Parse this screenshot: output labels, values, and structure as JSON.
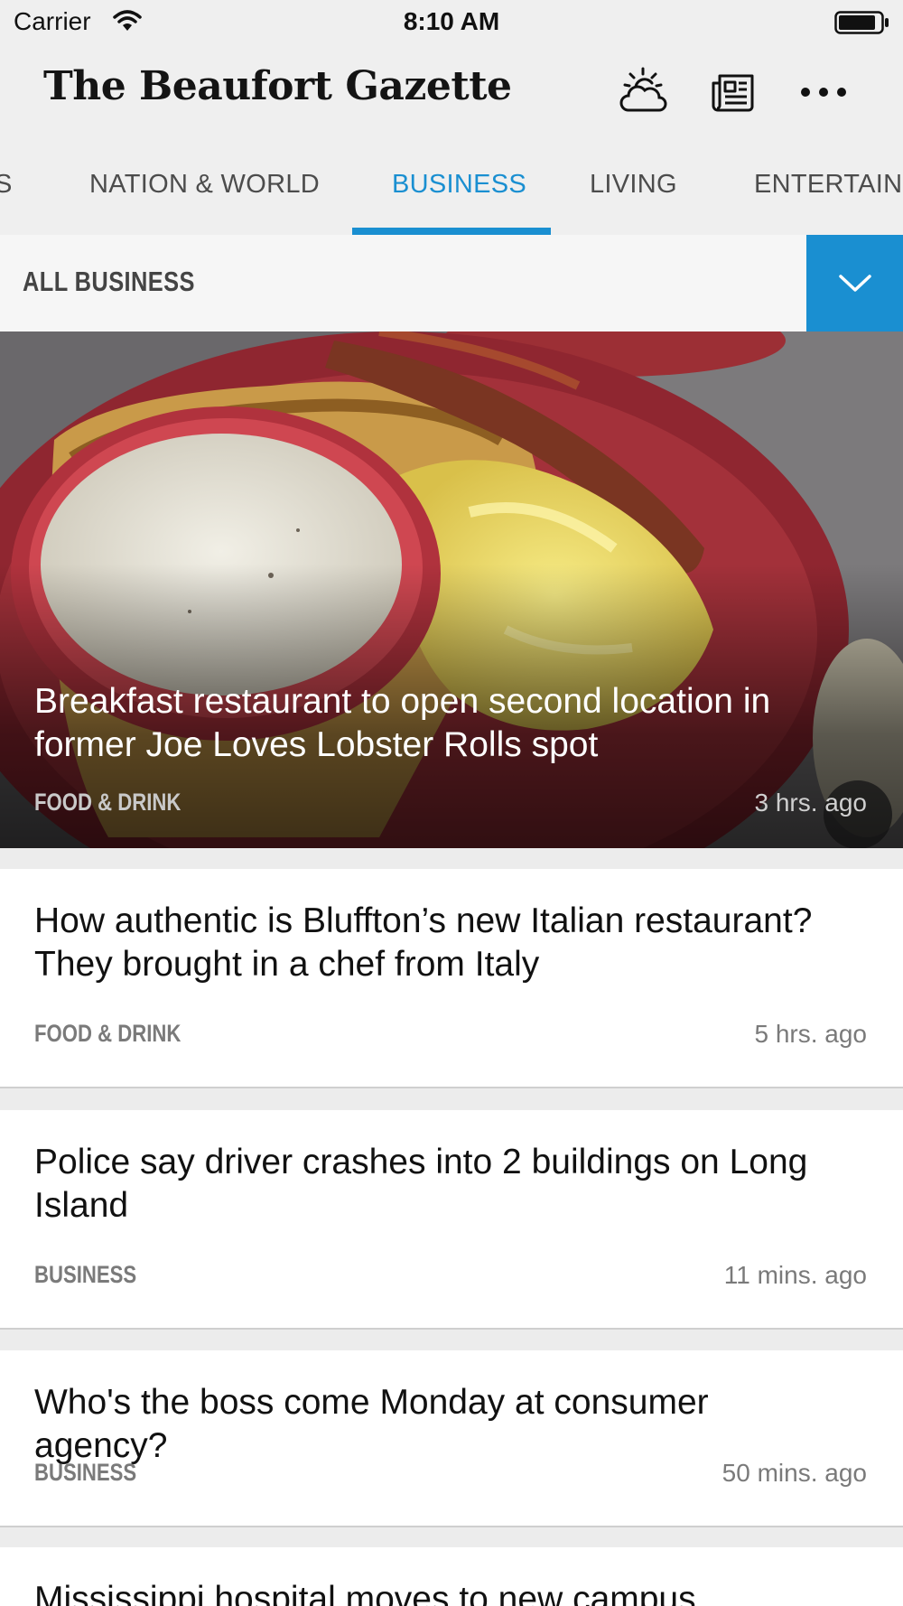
{
  "status_bar": {
    "carrier": "Carrier",
    "time": "8:10 AM",
    "icons": [
      "wifi-icon",
      "battery-icon"
    ]
  },
  "header": {
    "masthead": "The Beaufort Gazette",
    "icons": [
      "weather-icon",
      "epaper-icon",
      "more-icon"
    ]
  },
  "tabs": {
    "items": [
      {
        "label": "S"
      },
      {
        "label": "NATION & WORLD"
      },
      {
        "label": "BUSINESS",
        "active": true
      },
      {
        "label": "LIVING"
      },
      {
        "label": "ENTERTAINM"
      }
    ]
  },
  "section": {
    "title": "ALL BUSINESS",
    "toggle_icon": "chevron-down-icon"
  },
  "colors": {
    "accent": "#1a8fd1",
    "background": "#ececec",
    "card": "#ffffff",
    "meta_text": "#7a7a7a"
  },
  "hero": {
    "headline": "Breakfast restaurant to open second location in former Joe Loves Lobster Rolls spot",
    "category": "FOOD & DRINK",
    "time": "3 hrs. ago"
  },
  "articles": [
    {
      "headline": "How authentic is Bluffton’s new Italian restaurant? They brought in a chef from Italy",
      "category": "FOOD & DRINK",
      "time": "5 hrs. ago"
    },
    {
      "headline": "Police say driver crashes into 2 buildings on Long Island",
      "category": "BUSINESS",
      "time": "11 mins. ago"
    },
    {
      "headline": "Who's the boss come Monday at consumer agency?",
      "category": "BUSINESS",
      "time": "50 mins. ago"
    },
    {
      "headline": "Mississippi hospital moves to new campus"
    }
  ]
}
